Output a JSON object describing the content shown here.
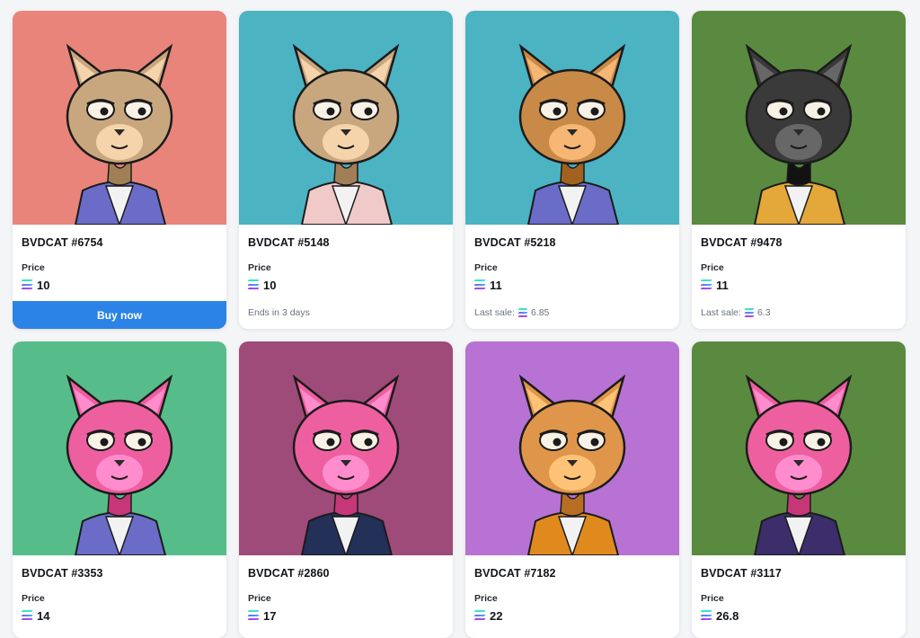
{
  "cards": [
    {
      "name": "BVDCAT #6754",
      "price_label": "Price",
      "price": "10",
      "footer_type": "button",
      "button_label": "Buy now",
      "bg": "#e8847a",
      "fur": "#c9a77e",
      "outfit": "#6a6cc8"
    },
    {
      "name": "BVDCAT #5148",
      "price_label": "Price",
      "price": "10",
      "footer_type": "text",
      "footer_text": "Ends in 3 days",
      "bg": "#4bb3c2",
      "fur": "#c9a77e",
      "outfit": "#f0c9c9"
    },
    {
      "name": "BVDCAT #5218",
      "price_label": "Price",
      "price": "11",
      "footer_type": "lastsale",
      "footer_text": "Last sale:",
      "footer_value": "6.85",
      "bg": "#4bb3c2",
      "fur": "#c98a48",
      "outfit": "#6a6cc8"
    },
    {
      "name": "BVDCAT #9478",
      "price_label": "Price",
      "price": "11",
      "footer_type": "lastsale",
      "footer_text": "Last sale:",
      "footer_value": "6.3",
      "bg": "#5a8a3f",
      "fur": "#3a3a3a",
      "outfit": "#e3a73a"
    },
    {
      "name": "BVDCAT #3353",
      "price_label": "Price",
      "price": "14",
      "bg": "#56bd8a",
      "fur": "#ee5fa0",
      "outfit": "#6a6cc8"
    },
    {
      "name": "BVDCAT #2860",
      "price_label": "Price",
      "price": "17",
      "bg": "#9e4b79",
      "fur": "#ee5fa0",
      "outfit": "#233058"
    },
    {
      "name": "BVDCAT #7182",
      "price_label": "Price",
      "price": "22",
      "bg": "#b772d3",
      "fur": "#e0964a",
      "outfit": "#e08a1e"
    },
    {
      "name": "BVDCAT #3117",
      "price_label": "Price",
      "price": "26.8",
      "bg": "#5a8a3f",
      "fur": "#ee5fa0",
      "outfit": "#3c2d6b"
    }
  ]
}
